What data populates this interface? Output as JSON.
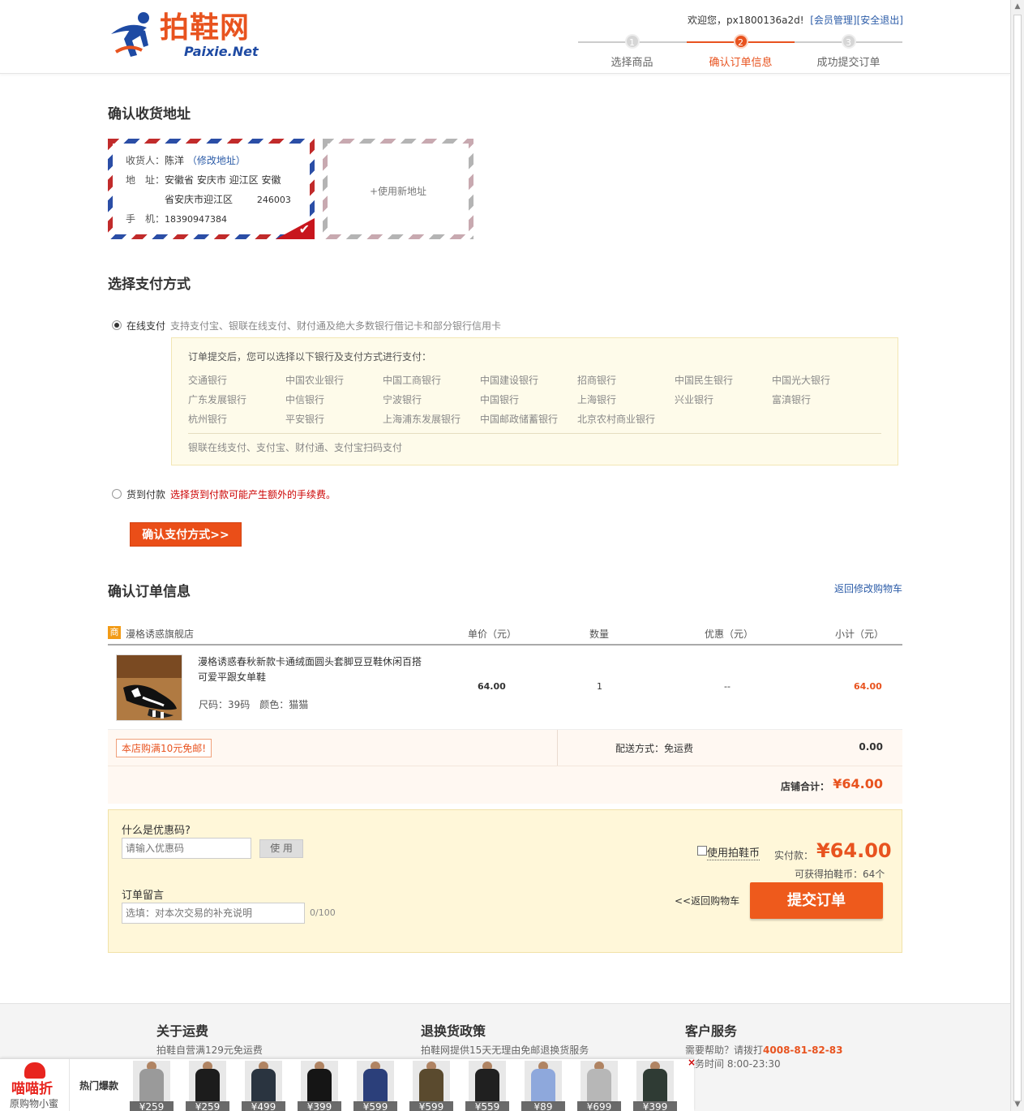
{
  "header": {
    "logo_cn": "拍鞋网",
    "logo_en": "Paixie.Net",
    "welcome_prefix": "欢迎您，",
    "username": "px1800136a2d!",
    "member_link": "[会员管理]",
    "logout_link": "[安全退出]",
    "steps": [
      {
        "num": "1",
        "label": "选择商品",
        "active": false
      },
      {
        "num": "2",
        "label": "确认订单信息",
        "active": true
      },
      {
        "num": "3",
        "label": "成功提交订单",
        "active": false
      }
    ]
  },
  "address": {
    "title": "确认收货地址",
    "receiver_label": "收货人：",
    "receiver": "陈洋",
    "edit_link": "（修改地址）",
    "addr_label": "地　址：",
    "addr_line1": "安徽省 安庆市 迎江区 安徽",
    "addr_line2": "省安庆市迎江区",
    "zip": "246003",
    "phone_label": "手　机：",
    "phone": "18390947384",
    "new_address": "+使用新地址"
  },
  "payment": {
    "title": "选择支付方式",
    "online_label": "在线支付",
    "online_desc": "支持支付宝、银联在线支付、财付通及绝大多数银行借记卡和部分银行信用卡",
    "box_header": "订单提交后，您可以选择以下银行及支付方式进行支付：",
    "banks_row1": [
      "交通银行",
      "中国农业银行",
      "中国工商银行",
      "中国建设银行",
      "招商银行",
      "中国民生银行",
      "中国光大银行"
    ],
    "banks_row2": [
      "广东发展银行",
      "中信银行",
      "宁波银行",
      "中国银行",
      "上海银行",
      "兴业银行",
      "富滇银行"
    ],
    "banks_row3": [
      "杭州银行",
      "平安银行",
      "上海浦东发展银行",
      "中国邮政储蓄银行",
      "北京农村商业银行"
    ],
    "box_footer": "银联在线支付、支付宝、财付通、支付宝扫码支付",
    "cod_label": "货到付款",
    "cod_warning": "选择货到付款可能产生额外的手续费。",
    "confirm_button": "确认支付方式>>"
  },
  "order": {
    "title": "确认订单信息",
    "back_link": "返回修改购物车",
    "shop_icon": "商",
    "shop_name": "漫格诱惑旗舰店",
    "col_price": "单价（元）",
    "col_qty": "数量",
    "col_discount": "优惠（元）",
    "col_subtotal": "小计（元）",
    "product_name": "漫格诱惑春秋新款卡通绒面圆头套脚豆豆鞋休闲百搭可爱平跟女单鞋",
    "product_spec": "尺码：39码　颜色：猫猫",
    "price": "64.00",
    "qty": "1",
    "discount": "--",
    "subtotal": "64.00",
    "promo": "本店购满10元免邮!",
    "shipping_way": "配送方式：免运费",
    "shipping_fee": "0.00",
    "shop_total_label": "店铺合计：",
    "shop_total": "¥64.00"
  },
  "checkout": {
    "coupon_question": "什么是优惠码?",
    "coupon_placeholder": "请输入优惠码",
    "use_button": "使 用",
    "memo_label": "订单留言",
    "memo_placeholder": "选填：对本次交易的补充说明",
    "memo_count": "0/100",
    "use_coin_label": "使用拍鞋币",
    "pay_label": "实付款：",
    "pay_amount": "¥64.00",
    "earn_text": "可获得拍鞋币：64个",
    "back_cart": "<<返回购物车",
    "submit_button": "提交订单"
  },
  "footer": {
    "col1_title": "关于运费",
    "col1_text": "拍鞋自营满129元免运费",
    "col2_title": "退换货政策",
    "col2_text": "拍鞋网提供15天无理由免邮退换货服务",
    "col3_title": "客户服务",
    "col3_text": "需要帮助？请拨打",
    "col3_phone": "4008-81-82-83",
    "col3_hours": "服务时间 8:00-23:30"
  },
  "adbar": {
    "brand": "喵喵折",
    "brand_sub": "原购物小蜜",
    "hot_label": "热门爆款",
    "close": "×",
    "items": [
      {
        "price": "¥259",
        "color": "#9a9a9a"
      },
      {
        "price": "¥259",
        "color": "#1c1c1c"
      },
      {
        "price": "¥499",
        "color": "#2a3440"
      },
      {
        "price": "¥399",
        "color": "#151515"
      },
      {
        "price": "¥599",
        "color": "#2b3f7a"
      },
      {
        "price": "¥599",
        "color": "#5a4a2e"
      },
      {
        "price": "¥559",
        "color": "#202020"
      },
      {
        "price": "¥89",
        "color": "#8ea8dc"
      },
      {
        "price": "¥699",
        "color": "#b7b7b7"
      },
      {
        "price": "¥399",
        "color": "#2f3b34"
      }
    ]
  }
}
